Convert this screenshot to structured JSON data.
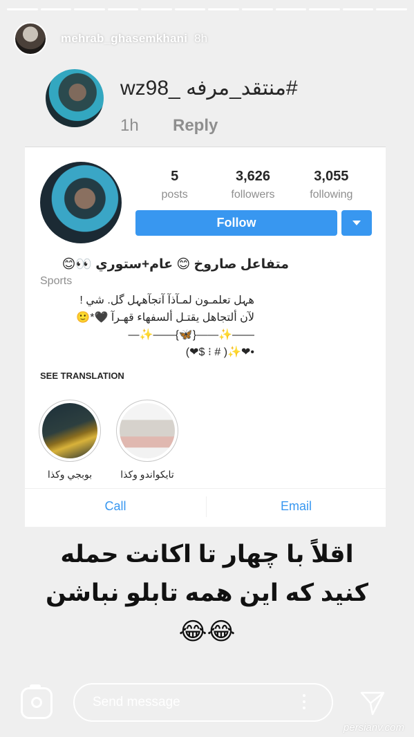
{
  "story": {
    "username": "mehrab_ghasemkhani",
    "time": "8h"
  },
  "comment": {
    "username": "wz98_ منتقد_مرفه#",
    "time": "1h",
    "reply_label": "Reply"
  },
  "profile": {
    "stats": [
      {
        "value": "5",
        "label": "posts"
      },
      {
        "value": "3,626",
        "label": "followers"
      },
      {
        "value": "3,055",
        "label": "following"
      }
    ],
    "follow_label": "Follow",
    "name": "متفاعل صاروخ 😊 عام+ستوري 👀😊",
    "category": "Sports",
    "bio": "هہل تعلمـون لمـآذآ آتجآهہل گل. شي !\nلآن ألتجاهل يقتـل ألسفهاء قهـرآ 🖤*🙂\n——✨——{🦋}——✨—\n•❤✨( # ⁝ $❤)",
    "see_translation": "SEE TRANSLATION",
    "highlights": [
      {
        "label": "بوبجي وكذا",
        "icon": "pubg-highlight"
      },
      {
        "label": "تايكواندو وكذا",
        "icon": "taekwondo-highlight"
      }
    ],
    "call_label": "Call",
    "email_label": "Email"
  },
  "caption": "اقلاً با چهار تا اکانت حمله\nکنید که این همه تابلو نباشن\n😂😂",
  "message": {
    "placeholder": "Send message"
  },
  "watermark": "persianv.com",
  "colors": {
    "accent": "#3897f0",
    "background": "#efefef"
  }
}
